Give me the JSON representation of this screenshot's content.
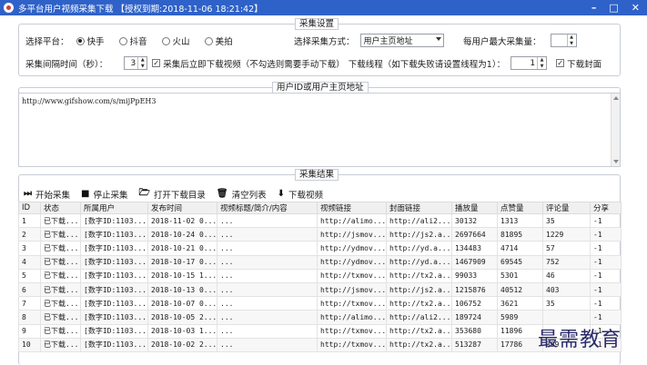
{
  "window": {
    "title": "多平台用户视频采集下载  【授权到期:2018-11-06 18:21:42】",
    "minimize": "–",
    "maximize": "□",
    "close": "✕"
  },
  "settings": {
    "legend": "采集设置",
    "platform_label": "选择平台：",
    "platforms": [
      {
        "label": "快手",
        "selected": true
      },
      {
        "label": "抖音",
        "selected": false
      },
      {
        "label": "火山",
        "selected": false
      },
      {
        "label": "美拍",
        "selected": false
      }
    ],
    "mode_label": "选择采集方式：",
    "mode_value": "用户主页地址",
    "max_label": "每用户最大采集量：",
    "max_value": "",
    "interval_label": "采集间隔时间（秒）：",
    "interval_value": "3",
    "auto_download_label": "采集后立即下载视频（不勾选则需要手动下载）",
    "threads_label": "下载线程（如下载失败请设置线程为1）：",
    "threads_value": "1",
    "cover_label": "下载封面",
    "auto_download_checked": true,
    "cover_checked": true
  },
  "urls": {
    "legend": "用户ID或用户主页地址",
    "value": "http://www.gifshow.com/s/mijPpEH3"
  },
  "results": {
    "legend": "采集结果",
    "toolbar": {
      "start": "开始采集",
      "stop": "停止采集",
      "open_dir": "打开下载目录",
      "clear": "清空列表",
      "download": "下载视频"
    },
    "columns": [
      "ID",
      "状态",
      "所属用户",
      "发布时间",
      "视频标题/简介/内容",
      "视频链接",
      "封面链接",
      "播放量",
      "点赞量",
      "评论量",
      "分享"
    ],
    "rows": [
      [
        "1",
        "已下载...",
        "[数字ID:1103...",
        "2018-11-02 0...",
        "...",
        "http://alimo...",
        "http://ali2...",
        "30132",
        "1313",
        "35",
        "-1"
      ],
      [
        "2",
        "已下载...",
        "[数字ID:1103...",
        "2018-10-24 0...",
        "...",
        "http://jsmov...",
        "http://js2.a...",
        "2697664",
        "81895",
        "1229",
        "-1"
      ],
      [
        "3",
        "已下载...",
        "[数字ID:1103...",
        "2018-10-21 0...",
        "...",
        "http://ydmov...",
        "http://yd.a...",
        "134483",
        "4714",
        "57",
        "-1"
      ],
      [
        "4",
        "已下载...",
        "[数字ID:1103...",
        "2018-10-17 0...",
        "...",
        "http://ydmov...",
        "http://yd.a...",
        "1467909",
        "69545",
        "752",
        "-1"
      ],
      [
        "5",
        "已下载...",
        "[数字ID:1103...",
        "2018-10-15 1...",
        "...",
        "http://txmov...",
        "http://tx2.a...",
        "99033",
        "5301",
        "46",
        "-1"
      ],
      [
        "6",
        "已下载...",
        "[数字ID:1103...",
        "2018-10-13 0...",
        "...",
        "http://jsmov...",
        "http://js2.a...",
        "1215876",
        "40512",
        "403",
        "-1"
      ],
      [
        "7",
        "已下载...",
        "[数字ID:1103...",
        "2018-10-07 0...",
        "...",
        "http://txmov...",
        "http://tx2.a...",
        "106752",
        "3621",
        "35",
        "-1"
      ],
      [
        "8",
        "已下载...",
        "[数字ID:1103...",
        "2018-10-05 2...",
        "...",
        "http://alimo...",
        "http://ali2...",
        "189724",
        "5989",
        "",
        "-1"
      ],
      [
        "9",
        "已下载...",
        "[数字ID:1103...",
        "2018-10-03 1...",
        "...",
        "http://txmov...",
        "http://tx2.a...",
        "353680",
        "11896",
        "",
        "-1"
      ],
      [
        "10",
        "已下载...",
        "[数字ID:1103...",
        "2018-10-02 2...",
        "...",
        "http://txmov...",
        "http://tx2.a...",
        "513287",
        "17786",
        "359",
        "-1"
      ]
    ]
  },
  "watermark": "最需教育"
}
